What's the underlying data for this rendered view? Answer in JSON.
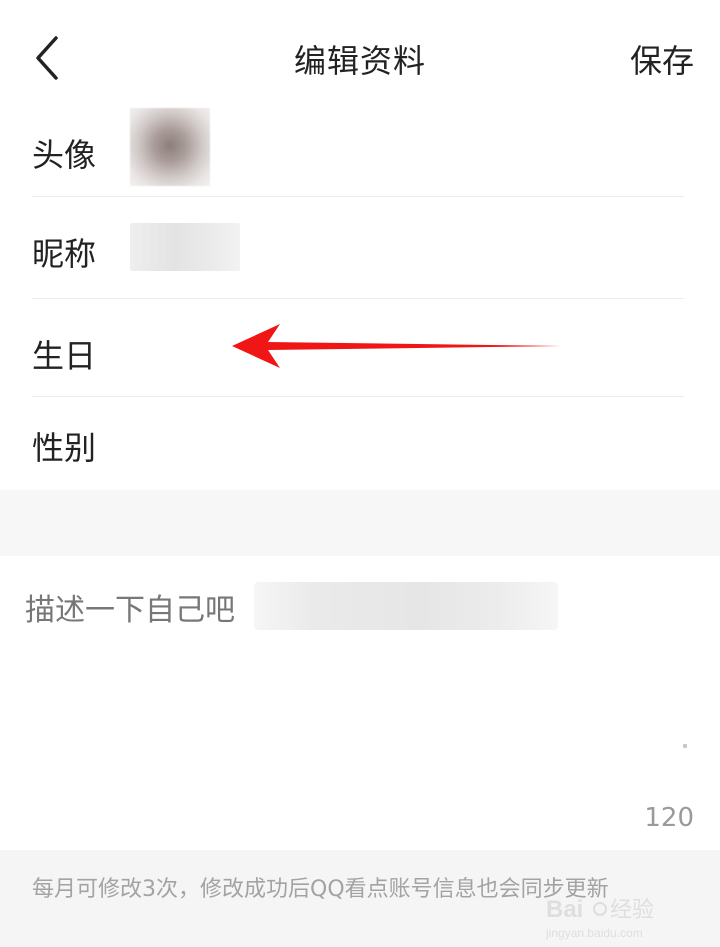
{
  "header": {
    "title": "编辑资料",
    "save_label": "保存",
    "back_icon": "chevron-left-icon"
  },
  "form": {
    "rows": [
      {
        "label": "头像",
        "value_type": "avatar-image"
      },
      {
        "label": "昵称",
        "value_type": "text"
      },
      {
        "label": "生日",
        "value_type": "date"
      },
      {
        "label": "性别",
        "value_type": "select"
      }
    ]
  },
  "description": {
    "placeholder": "描述一下自己吧",
    "counter": "120"
  },
  "footer": {
    "note": "每月可修改3次，修改成功后QQ看点账号信息也会同步更新"
  },
  "annotation": {
    "arrow_color": "#f01616"
  },
  "watermark": {
    "logo_text": "Bai 经验",
    "url_text": "jingyan.baidu.com"
  },
  "colors": {
    "text_primary": "#222222",
    "text_placeholder": "#777777",
    "band_background": "#f7f7f7",
    "footer_background": "#f5f5f5",
    "footer_text": "#a3a3a3"
  }
}
